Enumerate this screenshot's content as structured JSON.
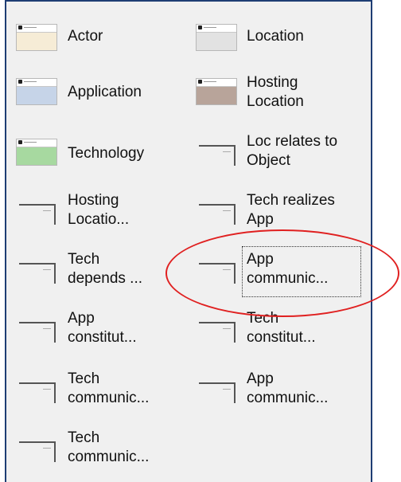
{
  "palette": {
    "items": [
      {
        "label": "Actor",
        "type": "element",
        "color": "#f6ecd6"
      },
      {
        "label": "Location",
        "type": "element",
        "color": "#e2e2e2"
      },
      {
        "label": "Application",
        "type": "element",
        "color": "#c6d4e8"
      },
      {
        "label": "Hosting\nLocation",
        "type": "element",
        "color": "#b8a49a"
      },
      {
        "label": "Technology",
        "type": "element",
        "color": "#a7d9a0"
      },
      {
        "label": "Loc relates to\nObject",
        "type": "relation"
      },
      {
        "label": "Hosting\nLocatio...",
        "type": "relation"
      },
      {
        "label": "Tech realizes\nApp",
        "type": "relation"
      },
      {
        "label": "Tech\ndepends ...",
        "type": "relation"
      },
      {
        "label": "App\ncommunic...",
        "type": "relation",
        "focused": true
      },
      {
        "label": "App\nconstitut...",
        "type": "relation"
      },
      {
        "label": "Tech\nconstitut...",
        "type": "relation"
      },
      {
        "label": "Tech\ncommunic...",
        "type": "relation"
      },
      {
        "label": "App\ncommunic...",
        "type": "relation"
      },
      {
        "label": "Tech\ncommunic...",
        "type": "relation"
      }
    ]
  },
  "annotation": {
    "color": "#e02020",
    "target": "App\ncommunic..."
  }
}
